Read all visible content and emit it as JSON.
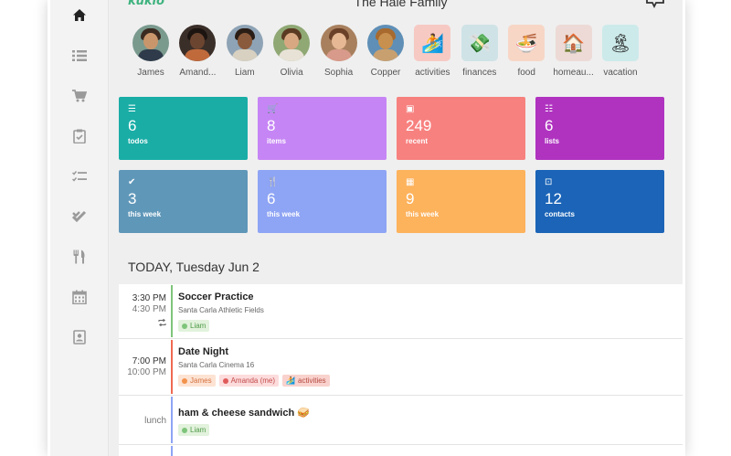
{
  "app": {
    "logo": "kukio",
    "title": "The Hale Family"
  },
  "nav": [
    {
      "icon": "home-icon",
      "active": true
    },
    {
      "icon": "list-icon"
    },
    {
      "icon": "cart-icon"
    },
    {
      "icon": "clipboard-icon"
    },
    {
      "icon": "checklist-icon"
    },
    {
      "icon": "double-check-icon"
    },
    {
      "icon": "fork-knife-icon"
    },
    {
      "icon": "calendar-icon"
    },
    {
      "icon": "contact-card-icon"
    }
  ],
  "members": [
    {
      "name": "James",
      "kind": "person",
      "bg": "#7a9a8e",
      "skin": "#c9966b",
      "hair": "#3a2a20",
      "shirt": "#2f3b4a"
    },
    {
      "name": "Amand...",
      "kind": "person",
      "bg": "#3a2e28",
      "skin": "#6b4530",
      "hair": "#1c1410",
      "shirt": "#c06a3c"
    },
    {
      "name": "Liam",
      "kind": "person",
      "bg": "#8ea3b5",
      "skin": "#8a5a3c",
      "hair": "#2a1d15",
      "shirt": "#d8d0c0"
    },
    {
      "name": "Olivia",
      "kind": "person",
      "bg": "#8fa874",
      "skin": "#d8a882",
      "hair": "#5a3a22",
      "shirt": "#e8e2d6"
    },
    {
      "name": "Sophia",
      "kind": "person",
      "bg": "#a8805e",
      "skin": "#e6b894",
      "hair": "#6a4028",
      "shirt": "#d89a8a"
    },
    {
      "name": "Copper",
      "kind": "person",
      "bg": "#5f8fb6",
      "skin": "#c8904e",
      "hair": "#a86a2e",
      "shirt": "#c8a070"
    },
    {
      "name": "activities",
      "kind": "category",
      "bg": "#f7c9c3",
      "glyph": "🏄"
    },
    {
      "name": "finances",
      "kind": "category",
      "bg": "#cfe3e6",
      "glyph": "💸"
    },
    {
      "name": "food",
      "kind": "category",
      "bg": "#f7d6c6",
      "glyph": "🍜"
    },
    {
      "name": "homeau...",
      "kind": "category",
      "bg": "#eddad6",
      "glyph": "🏠"
    },
    {
      "name": "vacation",
      "kind": "category",
      "bg": "#cdeaea",
      "glyph": "🏝"
    }
  ],
  "cards": [
    {
      "icon": "☰",
      "value": "6",
      "label": "todos",
      "color": "#19ada6"
    },
    {
      "icon": "🛒",
      "value": "8",
      "label": "items",
      "color": "#c685f5"
    },
    {
      "icon": "▣",
      "value": "249",
      "label": "recent",
      "color": "#f7817f"
    },
    {
      "icon": "☷",
      "value": "6",
      "label": "lists",
      "color": "#b033c0"
    },
    {
      "icon": "✔",
      "value": "3",
      "label": "this week",
      "color": "#5f97b9"
    },
    {
      "icon": "🍴",
      "value": "6",
      "label": "this week",
      "color": "#8ea4f4"
    },
    {
      "icon": "▦",
      "value": "9",
      "label": "this week",
      "color": "#fdb25c"
    },
    {
      "icon": "⊡",
      "value": "12",
      "label": "contacts",
      "color": "#1b64b7"
    }
  ],
  "today": {
    "heading": "TODAY, Tuesday Jun 2"
  },
  "events": [
    {
      "time_start": "3:30 PM",
      "time_end": "4:30 PM",
      "repeat": true,
      "title": "Soccer Practice",
      "subtitle": "Santa Carla Athletic Fields",
      "bar": "#7ec47a",
      "tags": [
        {
          "label": "Liam",
          "bg": "#e2f2dc",
          "fg": "#4f9a48",
          "dot": "#7ec47a"
        }
      ]
    },
    {
      "time_start": "7:00 PM",
      "time_end": "10:00 PM",
      "repeat": false,
      "title": "Date Night",
      "subtitle": "Santa Carla Cinema 16",
      "bar": "#f06a52",
      "tags": [
        {
          "label": "James",
          "bg": "#fde3d3",
          "fg": "#d4703e",
          "dot": "#f2924c"
        },
        {
          "label": "Amanda (me)",
          "bg": "#fcdcdc",
          "fg": "#c44a4a",
          "dot": "#e05a5a"
        },
        {
          "label": "activities",
          "bg": "#f9d2cd",
          "fg": "#b54a40",
          "dot": "",
          "glyph": "🏄"
        }
      ]
    },
    {
      "time_start": "lunch",
      "time_end": "",
      "repeat": false,
      "title": "ham & cheese sandwich 🥪",
      "subtitle": "",
      "bar": "#8ea4f4",
      "tags": [
        {
          "label": "Liam",
          "bg": "#e2f2dc",
          "fg": "#4f9a48",
          "dot": "#7ec47a"
        }
      ]
    }
  ]
}
